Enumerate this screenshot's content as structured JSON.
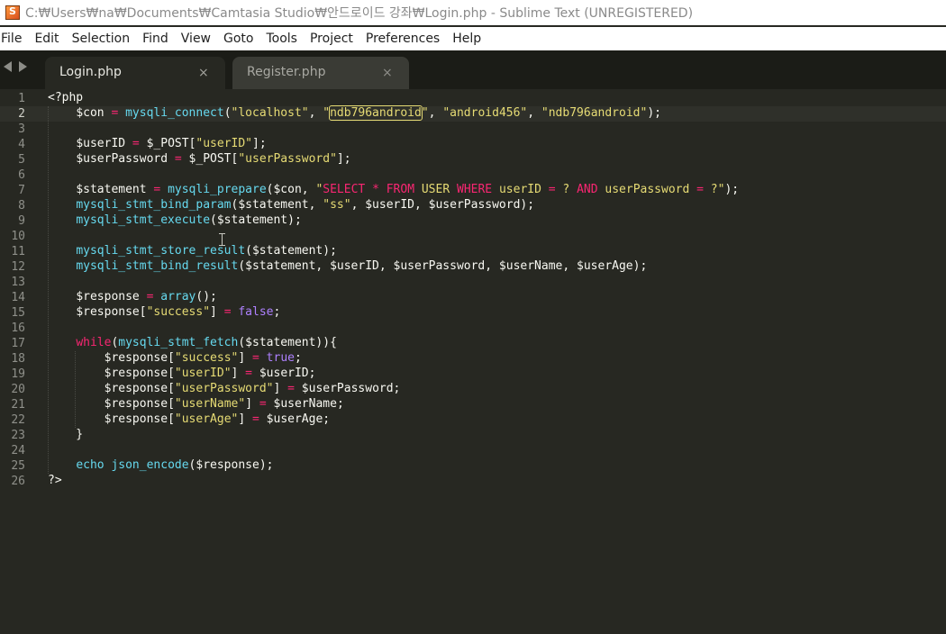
{
  "window": {
    "title": "C:₩Users₩na₩Documents₩Camtasia Studio₩안드로이드 강좌₩Login.php - Sublime Text (UNREGISTERED)",
    "app_icon": "sublime-text-icon"
  },
  "menu": [
    "File",
    "Edit",
    "Selection",
    "Find",
    "View",
    "Goto",
    "Tools",
    "Project",
    "Preferences",
    "Help"
  ],
  "tabs": [
    {
      "label": "Login.php",
      "close": "×",
      "active": true
    },
    {
      "label": "Register.php",
      "close": "×",
      "active": false
    }
  ],
  "editor": {
    "current_line": 2,
    "lines": [
      [
        [
          "plain",
          "<?php"
        ]
      ],
      [
        [
          "plain",
          "    "
        ],
        [
          "var",
          "$con"
        ],
        [
          "kw",
          " = "
        ],
        [
          "fn",
          "mysqli_connect"
        ],
        [
          "plain",
          "("
        ],
        [
          "str",
          "\"localhost\""
        ],
        [
          "plain",
          ", "
        ],
        [
          "str",
          "\""
        ],
        [
          "sel",
          "ndb796android"
        ],
        [
          "str",
          "\""
        ],
        [
          "plain",
          ", "
        ],
        [
          "str",
          "\"android456\""
        ],
        [
          "plain",
          ", "
        ],
        [
          "str",
          "\"ndb796android\""
        ],
        [
          "plain",
          ");"
        ]
      ],
      [],
      [
        [
          "plain",
          "    "
        ],
        [
          "var",
          "$userID"
        ],
        [
          "kw",
          " = "
        ],
        [
          "var",
          "$_POST"
        ],
        [
          "plain",
          "["
        ],
        [
          "str",
          "\"userID\""
        ],
        [
          "plain",
          "];"
        ]
      ],
      [
        [
          "plain",
          "    "
        ],
        [
          "var",
          "$userPassword"
        ],
        [
          "kw",
          " = "
        ],
        [
          "var",
          "$_POST"
        ],
        [
          "plain",
          "["
        ],
        [
          "str",
          "\"userPassword\""
        ],
        [
          "plain",
          "];"
        ]
      ],
      [],
      [
        [
          "plain",
          "    "
        ],
        [
          "var",
          "$statement"
        ],
        [
          "kw",
          " = "
        ],
        [
          "fn",
          "mysqli_prepare"
        ],
        [
          "plain",
          "($con, "
        ],
        [
          "str",
          "\""
        ],
        [
          "kw",
          "SELECT * FROM"
        ],
        [
          "str",
          " USER "
        ],
        [
          "kw",
          "WHERE"
        ],
        [
          "str",
          " userID "
        ],
        [
          "kw",
          "="
        ],
        [
          "str",
          " ? "
        ],
        [
          "kw",
          "AND"
        ],
        [
          "str",
          " userPassword "
        ],
        [
          "kw",
          "="
        ],
        [
          "str",
          " ?\""
        ],
        [
          "plain",
          ");"
        ]
      ],
      [
        [
          "plain",
          "    "
        ],
        [
          "fn",
          "mysqli_stmt_bind_param"
        ],
        [
          "plain",
          "($statement, "
        ],
        [
          "str",
          "\"ss\""
        ],
        [
          "plain",
          ", $userID, $userPassword);"
        ]
      ],
      [
        [
          "plain",
          "    "
        ],
        [
          "fn",
          "mysqli_stmt_execute"
        ],
        [
          "plain",
          "($statement);"
        ]
      ],
      [],
      [
        [
          "plain",
          "    "
        ],
        [
          "fn",
          "mysqli_stmt_store_result"
        ],
        [
          "plain",
          "($statement);"
        ]
      ],
      [
        [
          "plain",
          "    "
        ],
        [
          "fn",
          "mysqli_stmt_bind_result"
        ],
        [
          "plain",
          "($statement, $userID, $userPassword, $userName, $userAge);"
        ]
      ],
      [],
      [
        [
          "plain",
          "    "
        ],
        [
          "var",
          "$response"
        ],
        [
          "kw",
          " = "
        ],
        [
          "fn",
          "array"
        ],
        [
          "plain",
          "();"
        ]
      ],
      [
        [
          "plain",
          "    "
        ],
        [
          "var",
          "$response"
        ],
        [
          "plain",
          "["
        ],
        [
          "str",
          "\"success\""
        ],
        [
          "plain",
          "]"
        ],
        [
          "kw",
          " = "
        ],
        [
          "const",
          "false"
        ],
        [
          "plain",
          ";"
        ]
      ],
      [],
      [
        [
          "plain",
          "    "
        ],
        [
          "kw",
          "while"
        ],
        [
          "plain",
          "("
        ],
        [
          "fn",
          "mysqli_stmt_fetch"
        ],
        [
          "plain",
          "($statement)){"
        ]
      ],
      [
        [
          "plain",
          "        "
        ],
        [
          "var",
          "$response"
        ],
        [
          "plain",
          "["
        ],
        [
          "str",
          "\"success\""
        ],
        [
          "plain",
          "]"
        ],
        [
          "kw",
          " = "
        ],
        [
          "const",
          "true"
        ],
        [
          "plain",
          ";"
        ]
      ],
      [
        [
          "plain",
          "        "
        ],
        [
          "var",
          "$response"
        ],
        [
          "plain",
          "["
        ],
        [
          "str",
          "\"userID\""
        ],
        [
          "plain",
          "]"
        ],
        [
          "kw",
          " = "
        ],
        [
          "plain",
          "$userID;"
        ]
      ],
      [
        [
          "plain",
          "        "
        ],
        [
          "var",
          "$response"
        ],
        [
          "plain",
          "["
        ],
        [
          "str",
          "\"userPassword\""
        ],
        [
          "plain",
          "]"
        ],
        [
          "kw",
          " = "
        ],
        [
          "plain",
          "$userPassword;"
        ]
      ],
      [
        [
          "plain",
          "        "
        ],
        [
          "var",
          "$response"
        ],
        [
          "plain",
          "["
        ],
        [
          "str",
          "\"userName\""
        ],
        [
          "plain",
          "]"
        ],
        [
          "kw",
          " = "
        ],
        [
          "plain",
          "$userName;"
        ]
      ],
      [
        [
          "plain",
          "        "
        ],
        [
          "var",
          "$response"
        ],
        [
          "plain",
          "["
        ],
        [
          "str",
          "\"userAge\""
        ],
        [
          "plain",
          "]"
        ],
        [
          "kw",
          " = "
        ],
        [
          "plain",
          "$userAge;"
        ]
      ],
      [
        [
          "plain",
          "    }"
        ]
      ],
      [],
      [
        [
          "plain",
          "    "
        ],
        [
          "fn",
          "echo"
        ],
        [
          "plain",
          " "
        ],
        [
          "fn",
          "json_encode"
        ],
        [
          "plain",
          "($response);"
        ]
      ],
      [
        [
          "plain",
          "?>"
        ]
      ]
    ]
  },
  "colors": {
    "background": "#272822",
    "keyword": "#f92672",
    "string": "#e6db74",
    "function": "#66d9ef",
    "constant": "#ae81ff"
  },
  "icons": {
    "nav_back": "triangle-left-icon",
    "nav_forward": "triangle-right-icon",
    "cursor": "ibeam-cursor-icon"
  }
}
